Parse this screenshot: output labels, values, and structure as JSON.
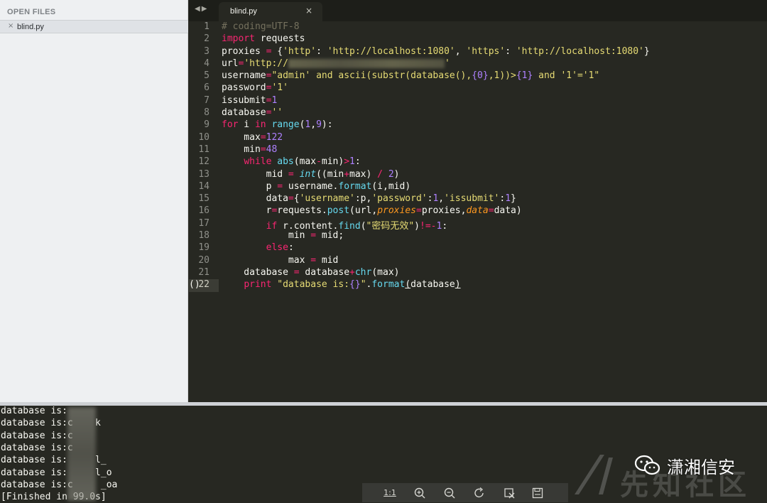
{
  "sidebar": {
    "heading": "OPEN FILES",
    "file_close": "×",
    "file_name": "blind.py"
  },
  "tabbar": {
    "nav_back": "◀",
    "nav_forward": "▶",
    "tab_label": "blind.py",
    "tab_close": "×"
  },
  "code": {
    "line_numbers": [
      "1",
      "2",
      "3",
      "4",
      "5",
      "6",
      "7",
      "8",
      "9",
      "10",
      "11",
      "12",
      "13",
      "14",
      "15",
      "16",
      "17",
      "18",
      "19",
      "20",
      "21",
      "22"
    ],
    "fold_marker": "()"
  },
  "output": {
    "lines": [
      "database is:",
      "database is:c    k",
      "database is:c",
      "database is:c     ",
      "database is:     l_",
      "database is:     l_o",
      "database is:c     _oa",
      "[Finished in 99.0s]"
    ]
  },
  "viewer_toolbar": {
    "one_to_one": "1:1",
    "zoom_in_icon": "zoom-in-icon",
    "zoom_out_icon": "zoom-out-icon",
    "rotate_icon": "rotate-icon",
    "crop_icon": "crop-icon",
    "save_icon": "save-icon"
  },
  "watermark": {
    "brand": "潇湘信安",
    "site": "先知社区"
  },
  "colors": {
    "editor_bg": "#272822",
    "sidebar_bg": "#eef0f2",
    "keyword": "#f92672",
    "string": "#e6db74",
    "number": "#ae81ff",
    "function": "#66d9ef",
    "param": "#fd971f",
    "comment": "#75715e"
  }
}
